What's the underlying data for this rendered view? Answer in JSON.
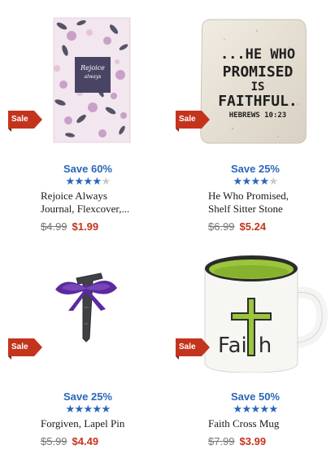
{
  "products": [
    {
      "sale_badge": "Sale",
      "save": "Save 60%",
      "rating": 4,
      "title": "Rejoice Always\nJournal, Flexcover,...",
      "old_price": "$4.99",
      "new_price": "$1.99",
      "image_text": [
        "Rejoice",
        "always"
      ],
      "image_name": "rejoice-journal-image",
      "colors": {
        "bg": "#f1e7f0",
        "accent": "#3b3552"
      }
    },
    {
      "sale_badge": "Sale",
      "save": "Save 25%",
      "rating": 4,
      "title": "He Who Promised,\nShelf Sitter Stone",
      "old_price": "$6.99",
      "new_price": "$5.24",
      "image_text": [
        "...HE WHO",
        "PROMISED",
        "IS",
        "FAITHFUL.",
        "HEBREWS 10:23"
      ],
      "image_name": "stone-block-image",
      "colors": {
        "bg": "#e8e3d8",
        "accent": "#1f1f1f"
      }
    },
    {
      "sale_badge": "Sale",
      "save": "Save 25%",
      "rating": 5,
      "title": "Forgiven, Lapel Pin",
      "old_price": "$5.99",
      "new_price": "$4.49",
      "image_text": [],
      "image_name": "nail-lapel-pin-image",
      "colors": {
        "bg": "#ffffff",
        "accent": "#5b2a9e"
      }
    },
    {
      "sale_badge": "Sale",
      "save": "Save 50%",
      "rating": 5,
      "title": "Faith Cross Mug",
      "old_price": "$7.99",
      "new_price": "$3.99",
      "image_text": [
        "Fai",
        "h"
      ],
      "image_name": "faith-mug-image",
      "colors": {
        "bg": "#ffffff",
        "accent": "#9bc53d"
      }
    }
  ]
}
